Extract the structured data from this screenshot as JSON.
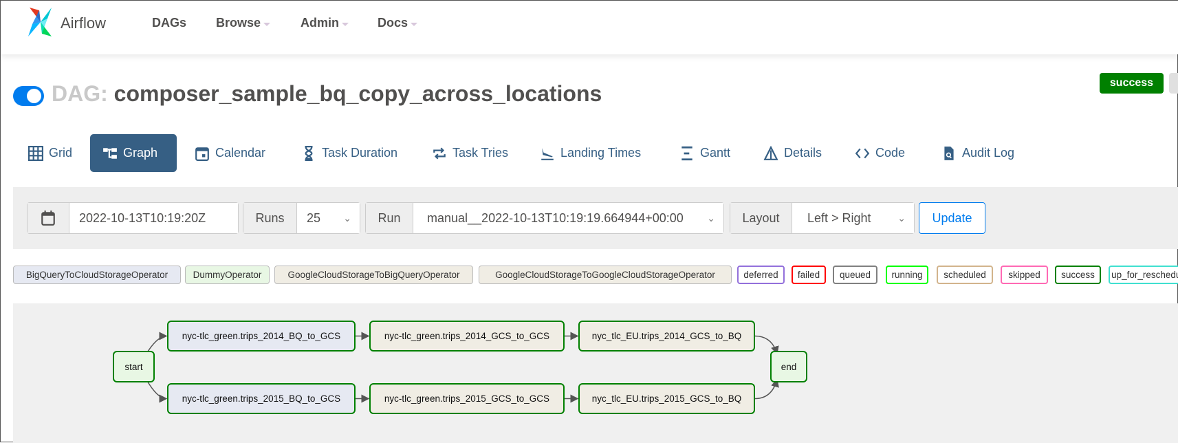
{
  "navbar": {
    "brand": "Airflow",
    "links": [
      {
        "label": "DAGs",
        "dropdown": false
      },
      {
        "label": "Browse",
        "dropdown": true
      },
      {
        "label": "Admin",
        "dropdown": true
      },
      {
        "label": "Docs",
        "dropdown": true
      }
    ]
  },
  "dag": {
    "prefix": "DAG:",
    "name": "composer_sample_bq_copy_across_locations",
    "paused": false,
    "status_badge": "success",
    "status_color": "#008000"
  },
  "tabs": [
    {
      "label": "Grid",
      "icon": "grid-icon"
    },
    {
      "label": "Graph",
      "icon": "graph-icon",
      "active": true
    },
    {
      "label": "Calendar",
      "icon": "calendar-icon"
    },
    {
      "label": "Task Duration",
      "icon": "hourglass-icon"
    },
    {
      "label": "Task Tries",
      "icon": "retry-icon"
    },
    {
      "label": "Landing Times",
      "icon": "plane-landing-icon"
    },
    {
      "label": "Gantt",
      "icon": "gantt-icon"
    },
    {
      "label": "Details",
      "icon": "triangle-icon"
    },
    {
      "label": "Code",
      "icon": "code-icon"
    },
    {
      "label": "Audit Log",
      "icon": "file-search-icon"
    }
  ],
  "filters": {
    "base_date": "2022-10-13T10:19:20Z",
    "runs_label": "Runs",
    "runs_value": "25",
    "run_label": "Run",
    "run_value": "manual__2022-10-13T10:19:19.664944+00:00",
    "layout_label": "Layout",
    "layout_value": "Left > Right",
    "update_label": "Update"
  },
  "legend": {
    "operators": [
      {
        "label": "BigQueryToCloudStorageOperator",
        "color": "#e6e9f2"
      },
      {
        "label": "DummyOperator",
        "color": "#e8f7e4"
      },
      {
        "label": "GoogleCloudStorageToBigQueryOperator",
        "color": "#f0ede4"
      },
      {
        "label": "GoogleCloudStorageToGoogleCloudStorageOperator",
        "color": "#f0ede4"
      }
    ],
    "states": [
      {
        "label": "deferred",
        "color": "#9370db"
      },
      {
        "label": "failed",
        "color": "#ff0000"
      },
      {
        "label": "queued",
        "color": "#808080"
      },
      {
        "label": "running",
        "color": "#00ff00"
      },
      {
        "label": "scheduled",
        "color": "#d2b48c"
      },
      {
        "label": "skipped",
        "color": "#ff69b4"
      },
      {
        "label": "success",
        "color": "#008000"
      },
      {
        "label": "up_for_reschedule",
        "color": "#40e0d0"
      }
    ]
  },
  "graph": {
    "nodes": [
      {
        "id": "start",
        "label": "start",
        "color": "#e8f7e4",
        "state": "success"
      },
      {
        "id": "a1",
        "label": "nyc-tlc_green.trips_2014_BQ_to_GCS",
        "color": "#e6e9f2",
        "state": "success"
      },
      {
        "id": "a2",
        "label": "nyc-tlc_green.trips_2014_GCS_to_GCS",
        "color": "#f0ede4",
        "state": "success"
      },
      {
        "id": "a3",
        "label": "nyc_tlc_EU.trips_2014_GCS_to_BQ",
        "color": "#f0ede4",
        "state": "success"
      },
      {
        "id": "b1",
        "label": "nyc-tlc_green.trips_2015_BQ_to_GCS",
        "color": "#e6e9f2",
        "state": "success"
      },
      {
        "id": "b2",
        "label": "nyc-tlc_green.trips_2015_GCS_to_GCS",
        "color": "#f0ede4",
        "state": "success"
      },
      {
        "id": "b3",
        "label": "nyc_tlc_EU.trips_2015_GCS_to_BQ",
        "color": "#f0ede4",
        "state": "success"
      },
      {
        "id": "end",
        "label": "end",
        "color": "#e8f7e4",
        "state": "success"
      }
    ],
    "edges": [
      [
        "start",
        "a1"
      ],
      [
        "a1",
        "a2"
      ],
      [
        "a2",
        "a3"
      ],
      [
        "a3",
        "end"
      ],
      [
        "start",
        "b1"
      ],
      [
        "b1",
        "b2"
      ],
      [
        "b2",
        "b3"
      ],
      [
        "b3",
        "end"
      ]
    ]
  }
}
